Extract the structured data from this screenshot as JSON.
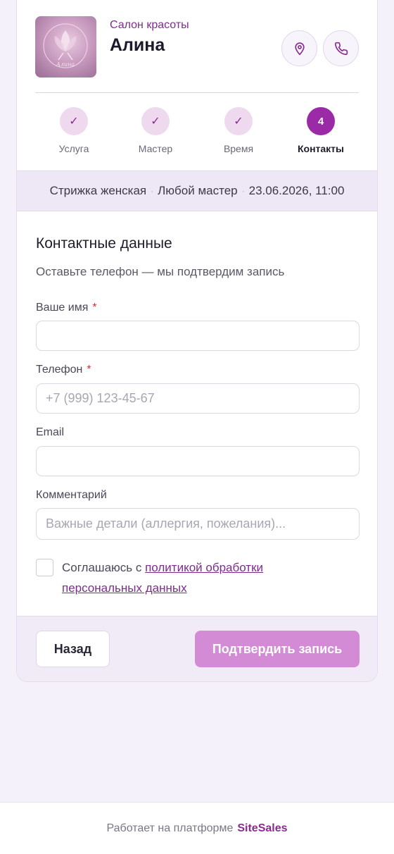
{
  "salon": {
    "type": "Салон красоты",
    "name": "Алина",
    "logo_text": "Алина"
  },
  "steps": [
    {
      "label": "Услуга",
      "state": "done",
      "icon": "check-icon"
    },
    {
      "label": "Мастер",
      "state": "done",
      "icon": "check-icon"
    },
    {
      "label": "Время",
      "state": "done",
      "icon": "check-icon"
    },
    {
      "label": "Контакты",
      "state": "active",
      "number": "4"
    }
  ],
  "summary": {
    "service": "Стрижка женская",
    "master": "Любой мастер",
    "datetime": "23.06.2026, 11:00",
    "separator": "·"
  },
  "form": {
    "title": "Контактные данные",
    "subtitle": "Оставьте телефон — мы подтвердим запись",
    "name_label": "Ваше имя",
    "name_value": "",
    "name_placeholder": "",
    "phone_label": "Телефон",
    "phone_value": "",
    "phone_placeholder": "+7 (999) 123-45-67",
    "email_label": "Email",
    "email_value": "",
    "email_placeholder": "",
    "comment_label": "Комментарий",
    "comment_value": "",
    "comment_placeholder": "Важные детали (аллергия, пожелания)...",
    "required_mark": "*",
    "consent_prefix": "Соглашаюсь с",
    "consent_link": "политикой обработки персональных данных",
    "consent_checked": false
  },
  "actions": {
    "back_label": "Назад",
    "confirm_label": "Подтвердить запись"
  },
  "footer": {
    "prefix": "Работает на платформе",
    "brand": "SiteSales"
  },
  "colors": {
    "accent": "#9b2aa6",
    "accent_light": "#efd9ef",
    "confirm_disabled": "#d38bd6",
    "background": "#f5f1fa"
  }
}
